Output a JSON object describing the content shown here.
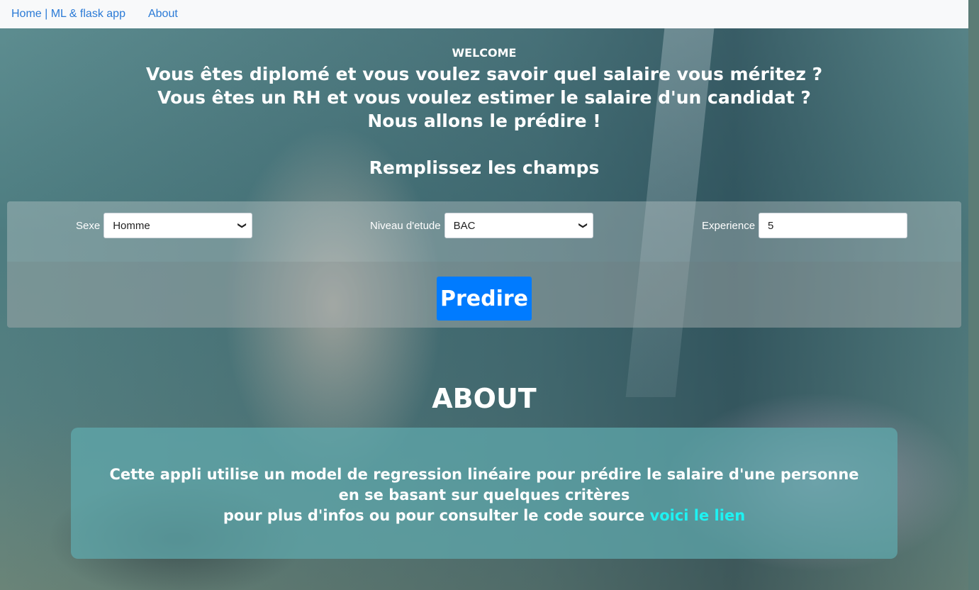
{
  "navbar": {
    "brand": "Home | ML & flask app",
    "about": "About"
  },
  "hero": {
    "welcome": "WELCOME",
    "line1": "Vous êtes diplomé et vous voulez savoir quel salaire vous méritez ?",
    "line2": "Vous êtes un RH et vous voulez estimer le salaire d'un candidat ?",
    "line3": "Nous allons le prédire !",
    "form_title": "Remplissez les champs"
  },
  "form": {
    "sexe_label": "Sexe",
    "sexe_value": "Homme",
    "niveau_label": "Niveau d'etude",
    "niveau_value": "BAC",
    "experience_label": "Experience",
    "experience_value": "5",
    "submit_label": "Predire"
  },
  "about": {
    "title": "ABOUT",
    "line1": "Cette appli utilise un model de regression linéaire pour prédire le salaire d'une personne en se basant sur quelques critères",
    "line2": "pour plus d'infos ou pour consulter le code source",
    "link_label": "voici le lien"
  },
  "colors": {
    "nav_bg": "#f8f9fa",
    "link": "#2a7ad6",
    "button": "#007bff",
    "about_link": "#1ef2f2"
  },
  "icons": {
    "select_arrow": "chevron-down-icon"
  }
}
